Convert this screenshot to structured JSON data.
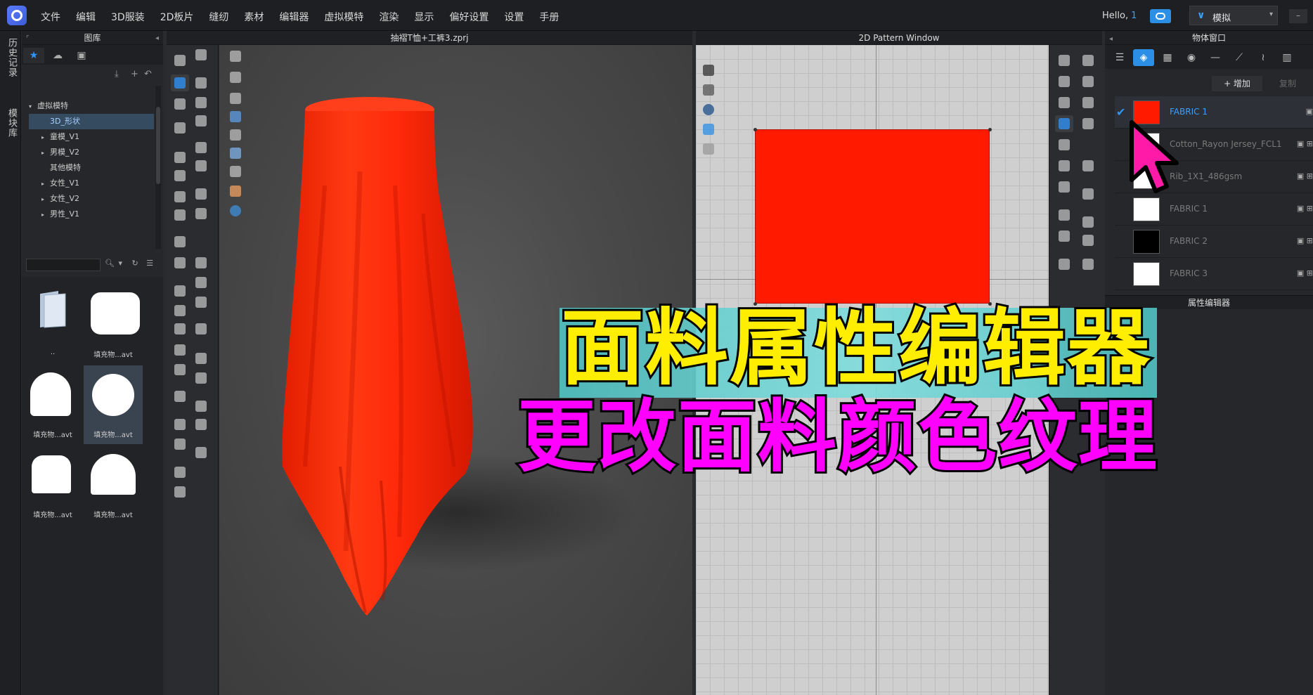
{
  "menubar": {
    "items": [
      "文件",
      "编辑",
      "3D服装",
      "2D板片",
      "缝纫",
      "素材",
      "编辑器",
      "虚拟模特",
      "渲染",
      "显示",
      "偏好设置",
      "设置",
      "手册"
    ],
    "hello": "Hello,",
    "hello_num": "1",
    "mode_label": "模拟",
    "minimize": "–"
  },
  "vstrip": {
    "history": "历史记录",
    "modules": "模块库"
  },
  "library": {
    "title": "图库",
    "tree": [
      {
        "label": "虚拟模特",
        "expanded": true
      },
      {
        "label": "3D_形状",
        "selected": true
      },
      {
        "label": "童模_V1"
      },
      {
        "label": "男模_V2"
      },
      {
        "label": "其他模特"
      },
      {
        "label": "女性_V1"
      },
      {
        "label": "女性_V2"
      },
      {
        "label": "男性_V1"
      }
    ],
    "thumbs": [
      {
        "label": "..",
        "icon": "folder-icon"
      },
      {
        "label": "填充物...avt",
        "icon": "rounded-rect-shape"
      },
      {
        "label": "填充物...avt",
        "icon": "arch-shape"
      },
      {
        "label": "填充物...avt",
        "icon": "circle-shape",
        "selected": true
      },
      {
        "label": "填充物...avt",
        "icon": "rounded-square-shape"
      },
      {
        "label": "填充物...avt",
        "icon": "round-top-shape"
      }
    ]
  },
  "view3d": {
    "title": "抽褶T恤+工裤3.zprj",
    "fabric_color": "#ff2a0a"
  },
  "view2d": {
    "title": "2D Pattern Window",
    "pattern_color": "#ff1a00"
  },
  "objwin": {
    "title": "物体窗口",
    "add_label": "+ 增加",
    "copy_label": "复制",
    "fabrics": [
      {
        "name": "FABRIC 1",
        "color": "#ff1a00",
        "selected": true
      },
      {
        "name": "Cotton_Rayon Jersey_FCL1",
        "color": "#ffffff"
      },
      {
        "name": "Rib_1X1_486gsm",
        "color": "#ffffff"
      },
      {
        "name": "FABRIC 1",
        "color": "#ffffff"
      },
      {
        "name": "FABRIC 2",
        "color": "#000000"
      },
      {
        "name": "FABRIC 3",
        "color": "#ffffff"
      }
    ],
    "attr_title": "属性编辑器"
  },
  "overlay": {
    "caption1": "面料属性编辑器",
    "caption2": "更改面料颜色纹理"
  }
}
